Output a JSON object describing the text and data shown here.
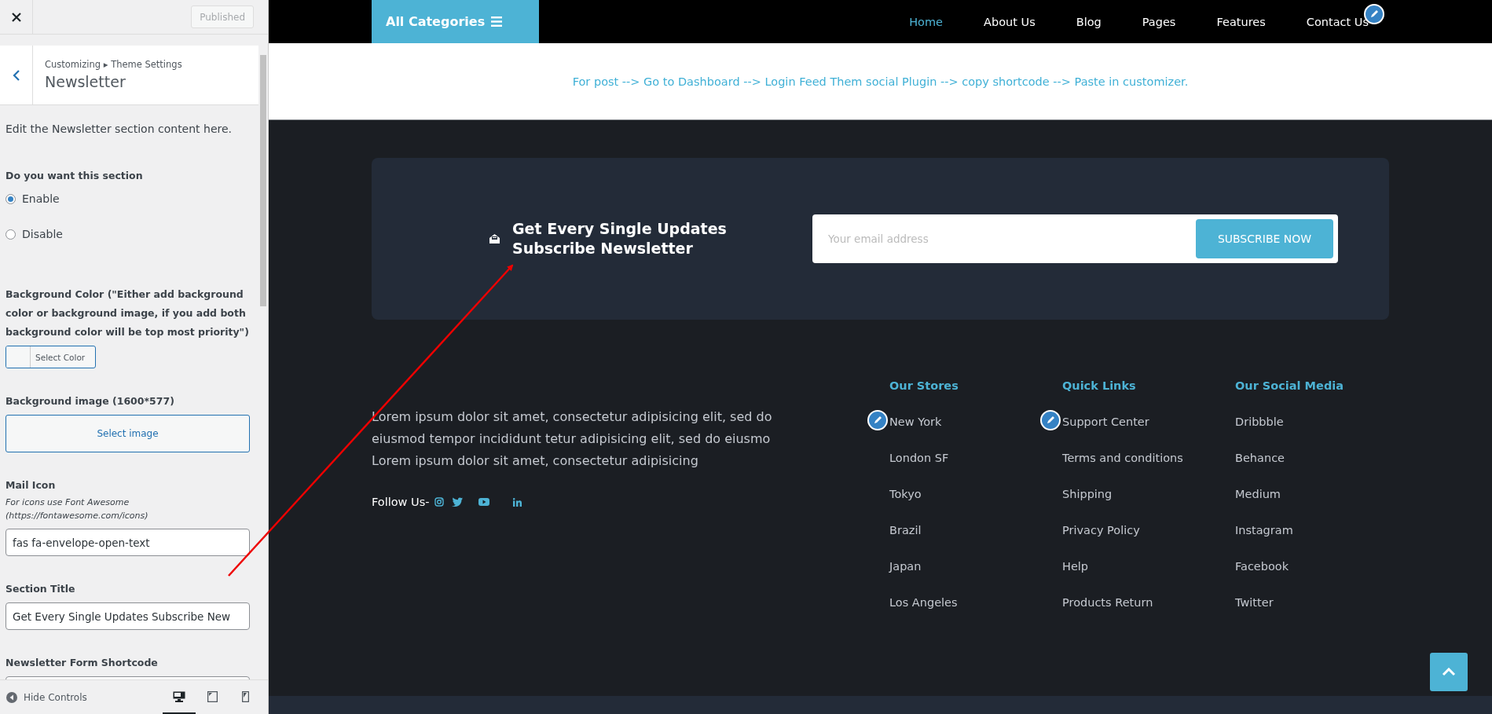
{
  "customizer": {
    "publish_button": {
      "label": "Published",
      "disabled": true
    },
    "breadcrumb": "Customizing ▸ Theme Settings",
    "title": "Newsletter",
    "description": "Edit the Newsletter section content here.",
    "controls": [
      {
        "kind": "radio",
        "label": "Do you want this section",
        "options": [
          {
            "label": "Enable",
            "selected": true
          },
          {
            "label": "Disable",
            "selected": false
          }
        ]
      },
      {
        "kind": "color",
        "label": "Background Color (\"Either add background color or background image, if you add both background color will be top most priority\")",
        "button": "Select Color"
      },
      {
        "kind": "image",
        "label": "Background image (1600*577)",
        "button": "Select image"
      },
      {
        "kind": "text",
        "label": "Mail Icon",
        "hint": "For icons use Font Awesome (https://fontawesome.com/icons)",
        "value": "fas fa-envelope-open-text"
      },
      {
        "kind": "text",
        "label": "Section Title",
        "value": "Get Every Single Updates Subscribe New"
      },
      {
        "kind": "text",
        "label": "Newsletter Form Shortcode"
      }
    ],
    "footer_bar": {
      "hide_controls": "Hide Controls",
      "devices": [
        {
          "kind": "desktop",
          "selected": true
        },
        {
          "kind": "tablet",
          "selected": false
        },
        {
          "kind": "mobile",
          "selected": false
        }
      ]
    }
  },
  "preview": {
    "nav": {
      "categories": "All Categories",
      "edit_shortcut": true,
      "links": [
        {
          "label": "Home",
          "selected": true
        },
        {
          "label": "About Us",
          "selected": false
        },
        {
          "label": "Blog",
          "selected": false
        },
        {
          "label": "Pages",
          "selected": false
        },
        {
          "label": "Features",
          "selected": false
        },
        {
          "label": "Contact Us",
          "selected": false
        }
      ]
    },
    "notice": "For post --> Go to Dashboard --> Login Feed Them social Plugin --> copy shortcode --> Paste in customizer.",
    "newsletter": {
      "title": "Get Every Single Updates Subscribe Newsletter",
      "placeholder": "Your email address",
      "button": "SUBSCRIBE NOW"
    },
    "footer": {
      "about": "Lorem ipsum dolor sit amet, consectetur adipisicing elit, sed do eiusmod tempor incididunt tetur adipisicing elit, sed do eiusmo Lorem ipsum dolor sit amet, consectetur adipisicing",
      "follow": "Follow Us-",
      "socials": [
        {
          "kind": "instagram"
        },
        {
          "kind": "twitter"
        },
        {
          "kind": "youtube"
        },
        {
          "kind": "linkedin"
        }
      ],
      "columns": [
        {
          "heading": "Our Stores",
          "edit_shortcut": true,
          "items": [
            "New York",
            "London SF",
            "Tokyo",
            "Brazil",
            "Japan",
            "Los Angeles"
          ]
        },
        {
          "heading": "Quick Links",
          "edit_shortcut": true,
          "items": [
            "Support Center",
            "Terms and conditions",
            "Shipping",
            "Privacy Policy",
            "Help",
            "Products Return"
          ]
        },
        {
          "heading": "Our Social Media",
          "edit_shortcut": false,
          "items": [
            "Dribbble",
            "Behance",
            "Medium",
            "Instagram",
            "Facebook",
            "Twitter"
          ]
        }
      ]
    }
  }
}
